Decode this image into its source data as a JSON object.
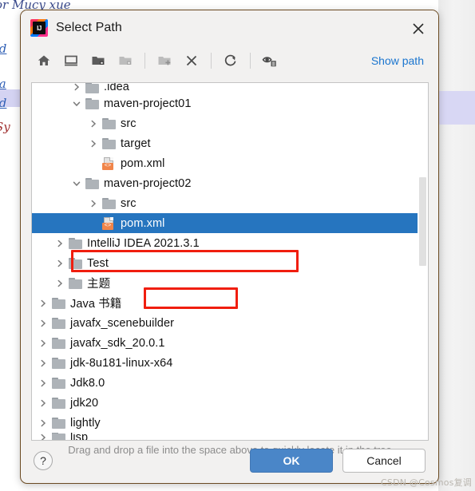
{
  "background": {
    "code_lines": [
      "or Mucy xue",
      "id",
      "la",
      "id",
      "Sy"
    ]
  },
  "dialog": {
    "title": "Select Path",
    "app_icon": "intellij-idea-icon",
    "close_icon": "close-icon"
  },
  "toolbar": {
    "buttons": [
      {
        "name": "home-icon",
        "tooltip": "Home",
        "enabled": true
      },
      {
        "name": "desktop-icon",
        "tooltip": "Desktop",
        "enabled": true
      },
      {
        "name": "project-folder-icon",
        "tooltip": "Project",
        "enabled": true
      },
      {
        "name": "module-folder-icon",
        "tooltip": "Module",
        "enabled": false
      },
      {
        "name": "new-folder-icon",
        "tooltip": "New Folder",
        "enabled": false
      },
      {
        "name": "delete-icon",
        "tooltip": "Delete",
        "enabled": true
      },
      {
        "name": "refresh-icon",
        "tooltip": "Refresh",
        "enabled": true
      },
      {
        "name": "show-hidden-icon",
        "tooltip": "Show Hidden Files",
        "enabled": true
      }
    ],
    "show_path_label": "Show path"
  },
  "tree": {
    "rows": [
      {
        "label": ".idea",
        "indent": 2,
        "twisty": "right",
        "icon": "folder",
        "selected": false,
        "clip": "top"
      },
      {
        "label": "maven-project01",
        "indent": 2,
        "twisty": "down",
        "icon": "folder",
        "selected": false,
        "clip": ""
      },
      {
        "label": "src",
        "indent": 3,
        "twisty": "right",
        "icon": "folder",
        "selected": false,
        "clip": ""
      },
      {
        "label": "target",
        "indent": 3,
        "twisty": "right",
        "icon": "folder",
        "selected": false,
        "clip": ""
      },
      {
        "label": "pom.xml",
        "indent": 3,
        "twisty": "none",
        "icon": "xml",
        "selected": false,
        "clip": ""
      },
      {
        "label": "maven-project02",
        "indent": 2,
        "twisty": "down",
        "icon": "folder",
        "selected": false,
        "clip": ""
      },
      {
        "label": "src",
        "indent": 3,
        "twisty": "right",
        "icon": "folder",
        "selected": false,
        "clip": ""
      },
      {
        "label": "pom.xml",
        "indent": 3,
        "twisty": "none",
        "icon": "xml",
        "selected": true,
        "clip": ""
      },
      {
        "label": "IntelliJ IDEA 2021.3.1",
        "indent": 1,
        "twisty": "right",
        "icon": "folder",
        "selected": false,
        "clip": ""
      },
      {
        "label": "Test",
        "indent": 1,
        "twisty": "right",
        "icon": "folder",
        "selected": false,
        "clip": ""
      },
      {
        "label": "主题",
        "indent": 1,
        "twisty": "right",
        "icon": "folder",
        "selected": false,
        "clip": ""
      },
      {
        "label": "Java 书籍",
        "indent": 0,
        "twisty": "right",
        "icon": "folder",
        "selected": false,
        "clip": ""
      },
      {
        "label": "javafx_scenebuilder",
        "indent": 0,
        "twisty": "right",
        "icon": "folder",
        "selected": false,
        "clip": ""
      },
      {
        "label": "javafx_sdk_20.0.1",
        "indent": 0,
        "twisty": "right",
        "icon": "folder",
        "selected": false,
        "clip": ""
      },
      {
        "label": "jdk-8u181-linux-x64",
        "indent": 0,
        "twisty": "right",
        "icon": "folder",
        "selected": false,
        "clip": ""
      },
      {
        "label": "Jdk8.0",
        "indent": 0,
        "twisty": "right",
        "icon": "folder",
        "selected": false,
        "clip": ""
      },
      {
        "label": "jdk20",
        "indent": 0,
        "twisty": "right",
        "icon": "folder",
        "selected": false,
        "clip": ""
      },
      {
        "label": "lightly",
        "indent": 0,
        "twisty": "right",
        "icon": "folder",
        "selected": false,
        "clip": ""
      },
      {
        "label": "lisp",
        "indent": 0,
        "twisty": "right",
        "icon": "folder",
        "selected": false,
        "clip": "bottom"
      }
    ],
    "xml_tag_glyph": "<>"
  },
  "annotations": {
    "highlight_color": "#f01e0f",
    "boxes": [
      {
        "name": "maven-project02-highlight"
      },
      {
        "name": "pom-xml-highlight"
      }
    ]
  },
  "hint": {
    "text": "Drag and drop a file into the space above to quickly locate it in the tree"
  },
  "footer": {
    "help_label": "?",
    "ok_label": "OK",
    "cancel_label": "Cancel"
  },
  "watermark": {
    "text": "CSDN @Cosmos复调"
  },
  "colors": {
    "selection_blue": "#2675bf",
    "ok_button_blue": "#4a86c8",
    "link_blue": "#1a75cf",
    "annotation_red": "#f01e0f",
    "folder_gray": "#aeb3b8",
    "xml_orange": "#f0854a"
  }
}
